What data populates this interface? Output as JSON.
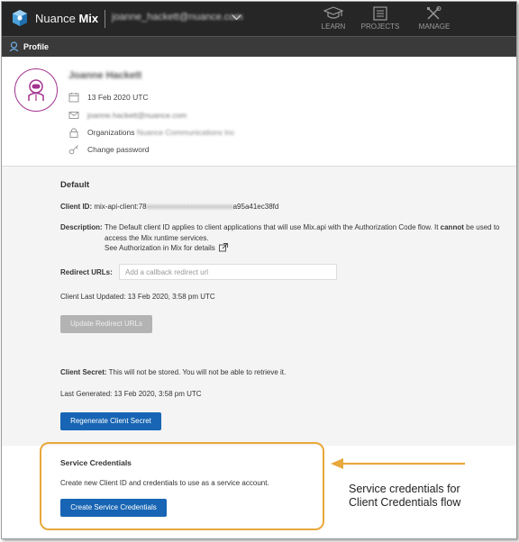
{
  "header": {
    "brand_prefix": "Nuance",
    "brand_product": "Mix",
    "account": "joanne_hackett@nuance.com",
    "nav": [
      {
        "label": "LEARN",
        "icon": "graduation-cap-icon"
      },
      {
        "label": "PROJECTS",
        "icon": "list-icon"
      },
      {
        "label": "MANAGE",
        "icon": "tools-icon"
      }
    ]
  },
  "profile_bar": {
    "label": "Profile"
  },
  "user": {
    "name": "Joanne Hackett",
    "created": "13 Feb 2020 UTC",
    "email": "joanne.hackett@nuance.com",
    "organizations_label": "Organizations",
    "organizations_value": "Nuance Communications Inc",
    "change_password": "Change password"
  },
  "client": {
    "section_title": "Default",
    "client_id_label": "Client ID:",
    "client_id_prefix": "mix-api-client:78",
    "client_id_masked": "xxxxxxxxxxxxxxxxxxxxxxxx",
    "client_id_suffix": "a95a41ec38fd",
    "description_label": "Description:",
    "description_text_1": "The Default client ID applies to client applications that will use Mix.api with the Authorization Code flow. It",
    "description_cannot": "cannot",
    "description_text_2": "be used to access the Mix runtime services.",
    "description_link": "See Authorization in Mix for details",
    "redirect_label": "Redirect URLs:",
    "redirect_placeholder": "Add a callback redirect url",
    "last_updated": "Client Last Updated:  13 Feb 2020, 3:58 pm UTC",
    "update_button": "Update Redirect URLs",
    "secret_label": "Client Secret:",
    "secret_text": "This will not be stored. You will not be able to retrieve it.",
    "last_generated": "Last Generated:  13 Feb 2020, 3:58 pm UTC",
    "regenerate_button": "Regenerate Client Secret"
  },
  "service": {
    "title": "Service Credentials",
    "text": "Create new Client ID and credentials to use as a service account.",
    "button": "Create Service Credentials"
  },
  "annotation": {
    "line1": "Service credentials for",
    "line2": "Client Credentials flow",
    "color": "#e8a83a"
  },
  "colors": {
    "topbar": "#262626",
    "primary": "#1765b4",
    "avatar_ring": "#a3328f",
    "section_bg": "#f4f4f4"
  }
}
